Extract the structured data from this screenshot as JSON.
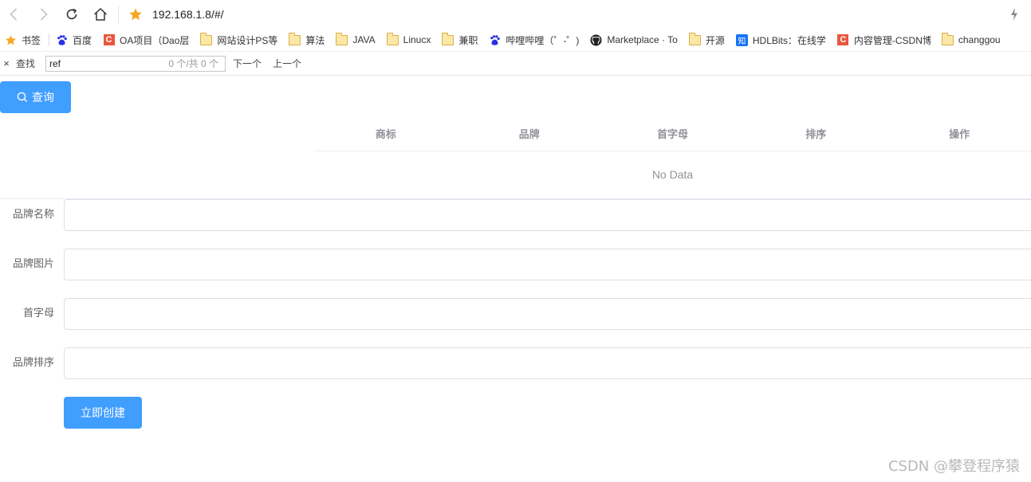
{
  "browser": {
    "url": "192.168.1.8/#/",
    "accent_star_color": "#f5a623"
  },
  "bookmarks": [
    {
      "label": "书签",
      "icon": "star-icon"
    },
    {
      "label": "百度",
      "icon": "baidu-paw-icon"
    },
    {
      "label": "OA项目（Dao层",
      "icon": "csdn-c-icon"
    },
    {
      "label": "网站设计PS等",
      "icon": "folder-icon"
    },
    {
      "label": "算法",
      "icon": "folder-icon"
    },
    {
      "label": "JAVA",
      "icon": "folder-icon"
    },
    {
      "label": "Linucx",
      "icon": "folder-icon"
    },
    {
      "label": "兼职",
      "icon": "folder-icon"
    },
    {
      "label": "哔哩哔哩（゜-゜)",
      "icon": "baidu-paw-icon"
    },
    {
      "label": "Marketplace · To",
      "icon": "github-icon"
    },
    {
      "label": "开源",
      "icon": "folder-icon"
    },
    {
      "label": "HDLBits：在线学",
      "icon": "zhihu-icon"
    },
    {
      "label": "内容管理-CSDN博",
      "icon": "csdn-c-icon"
    },
    {
      "label": "changgou",
      "icon": "folder-icon"
    }
  ],
  "findbar": {
    "close": "×",
    "label": "查找",
    "query": "ref",
    "count": "0 个/共 0 个",
    "next": "下一个",
    "prev": "上一个"
  },
  "query_button": {
    "label": "查询",
    "icon": "search-icon",
    "color": "#409eff"
  },
  "table": {
    "columns": [
      "商标",
      "品牌",
      "首字母",
      "排序",
      "操作"
    ],
    "empty_text": "No Data"
  },
  "form": {
    "fields": [
      {
        "label": "品牌名称",
        "value": ""
      },
      {
        "label": "品牌图片",
        "value": ""
      },
      {
        "label": "首字母",
        "value": ""
      },
      {
        "label": "品牌排序",
        "value": ""
      }
    ],
    "submit_label": "立即创建"
  },
  "watermark": "CSDN @攀登程序猿"
}
